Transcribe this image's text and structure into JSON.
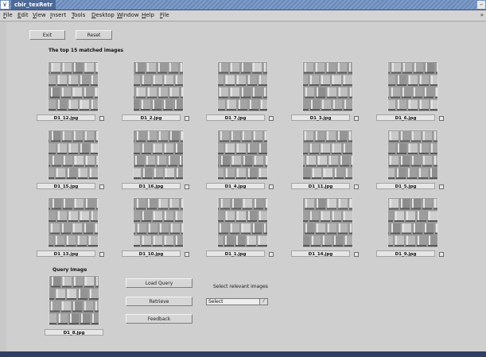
{
  "window": {
    "title": "cbir_texRetr",
    "menu_glyph": "∨",
    "right_glyph": "–"
  },
  "menu": {
    "items": [
      "File",
      "Edit",
      "View",
      "Insert",
      "Tools",
      "Desktop",
      "Window",
      "Help",
      "File"
    ],
    "more_glyph": "»"
  },
  "buttons": {
    "exit": "Exit",
    "reset": "Reset",
    "load_query": "Load Query",
    "retrieve": "Retrieve",
    "feedback": "Feedback"
  },
  "matched": {
    "heading": "The top 15 matched images",
    "images": [
      {
        "file": "D1_12.jpg",
        "icon": "texture-image-icon"
      },
      {
        "file": "D1_2.jpg",
        "icon": "texture-image-icon"
      },
      {
        "file": "D1_7.jpg",
        "icon": "texture-image-icon"
      },
      {
        "file": "D1_3.jpg",
        "icon": "texture-image-icon"
      },
      {
        "file": "D1_6.jpg",
        "icon": "texture-image-icon"
      },
      {
        "file": "D1_15.jpg",
        "icon": "texture-image-icon"
      },
      {
        "file": "D1_16.jpg",
        "icon": "texture-image-icon"
      },
      {
        "file": "D1_4.jpg",
        "icon": "texture-image-icon"
      },
      {
        "file": "D1_11.jpg",
        "icon": "texture-image-icon"
      },
      {
        "file": "D1_5.jpg",
        "icon": "texture-image-icon"
      },
      {
        "file": "D1_13.jpg",
        "icon": "texture-image-icon"
      },
      {
        "file": "D1_10.jpg",
        "icon": "texture-image-icon"
      },
      {
        "file": "D1_1.jpg",
        "icon": "texture-image-icon"
      },
      {
        "file": "D1_14.jpg",
        "icon": "texture-image-icon"
      },
      {
        "file": "D1_9.jpg",
        "icon": "texture-image-icon"
      }
    ]
  },
  "query": {
    "heading": "Query Image",
    "file": "D1_8.jpg"
  },
  "relevance": {
    "label": "Select relevant images",
    "select_value": "Select",
    "select_arrow": "/"
  },
  "colors": {
    "titlebar": "#6a89b8",
    "window_bg": "#c8c8c8",
    "texture_light": "#e4e4e4",
    "texture_dark": "#5a5a5a"
  }
}
